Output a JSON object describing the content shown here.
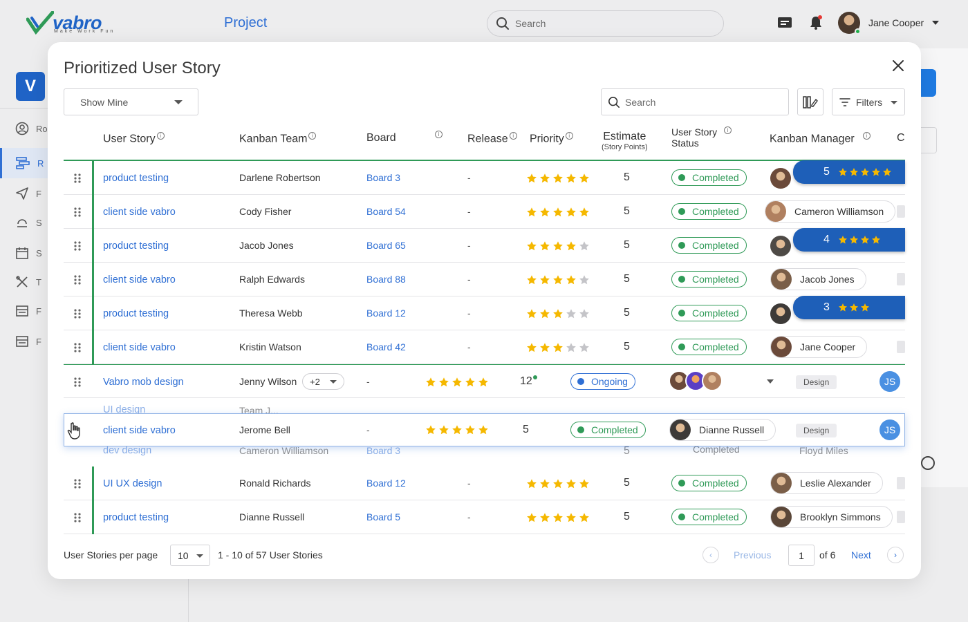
{
  "app": {
    "logo_text": "vabro",
    "logo_tagline": "Make Work Fun",
    "title": "Project",
    "search_placeholder": "Search",
    "user_name": "Jane Cooper",
    "side_logo": "V",
    "side_items": [
      "Ro",
      "R",
      "F",
      "S",
      "S",
      "T",
      "F",
      "F"
    ]
  },
  "modal": {
    "title": "Prioritized User Story",
    "show_mine": "Show Mine",
    "search_placeholder": "Search",
    "filters_label": "Filters",
    "columns": {
      "user_story": "User Story",
      "kanban_team": "Kanban Team",
      "board": "Board",
      "release": "Release",
      "priority": "Priority",
      "estimate": "Estimate",
      "estimate_sub": "(Story Points)",
      "status": "User Story Status",
      "manager": "Kanban Manager",
      "extra": "C"
    }
  },
  "rows": [
    {
      "story": "product testing",
      "team": "Darlene Robertson",
      "board": "Board 3",
      "release": "-",
      "stars": 5,
      "estimate": "5",
      "status": "Completed",
      "manager": "",
      "banner": "5",
      "banner_stars": 5
    },
    {
      "story": "client side vabro",
      "team": "Cody Fisher",
      "board": "Board 54",
      "release": "-",
      "stars": 5,
      "estimate": "5",
      "status": "Completed",
      "manager": "Cameron Williamson"
    },
    {
      "story": "product testing",
      "team": "Jacob Jones",
      "board": "Board 65",
      "release": "-",
      "stars": 4,
      "estimate": "5",
      "status": "Completed",
      "manager": "",
      "banner": "4",
      "banner_stars": 4
    },
    {
      "story": "client side vabro",
      "team": "Ralph Edwards",
      "board": "Board 88",
      "release": "-",
      "stars": 4,
      "estimate": "5",
      "status": "Completed",
      "manager": "Jacob Jones"
    },
    {
      "story": "product testing",
      "team": "Theresa Webb",
      "board": "Board 12",
      "release": "-",
      "stars": 3,
      "estimate": "5",
      "status": "Completed",
      "manager": "",
      "banner": "3",
      "banner_stars": 3
    },
    {
      "story": "client side vabro",
      "team": "Kristin Watson",
      "board": "Board 42",
      "release": "-",
      "stars": 3,
      "estimate": "5",
      "status": "Completed",
      "manager": "Jane Cooper"
    }
  ],
  "expanded_row": {
    "story": "Vabro mob design",
    "team": "Jenny Wilson",
    "team_extra": "+2",
    "release": "-",
    "stars": 5,
    "estimate": "12",
    "status": "Ongoing",
    "tag": "Design",
    "initials": "JS"
  },
  "ghost_rows": [
    {
      "story": "UI design",
      "team": "Team J...",
      "estimate": "5",
      "status": "Completed",
      "manager": "Dianne Russell"
    },
    {
      "story": "dev design",
      "team": "Cameron Williamson",
      "board": "Board 3",
      "estimate": "5",
      "status": "Completed",
      "manager": "Floyd Miles"
    }
  ],
  "drag_row": {
    "story": "client side vabro",
    "team": "Jerome Bell",
    "release": "-",
    "stars": 5,
    "estimate": "5",
    "status": "Completed",
    "manager": "Dianne Russell",
    "tag": "Design",
    "initials": "JS"
  },
  "bottom_rows": [
    {
      "story": "UI UX design",
      "team": "Ronald Richards",
      "board": "Board 12",
      "release": "-",
      "stars": 5,
      "estimate": "5",
      "status": "Completed",
      "manager": "Leslie Alexander"
    },
    {
      "story": "product testing",
      "team": "Dianne Russell",
      "board": "Board 5",
      "release": "-",
      "stars": 5,
      "estimate": "5",
      "status": "Completed",
      "manager": "Brooklyn Simmons"
    }
  ],
  "footer": {
    "per_page_label": "User Stories per page",
    "per_page_value": "10",
    "range_text": "1 - 10 of 57 User Stories",
    "previous": "Previous",
    "page": "1",
    "of_pages": "of 6",
    "next": "Next"
  },
  "colors": {
    "accent_blue": "#2f6fd4",
    "status_green": "#2f9a57",
    "star_yellow": "#f5b800",
    "star_grey": "#c4c4c8",
    "banner_blue": "#1e5fb8"
  }
}
